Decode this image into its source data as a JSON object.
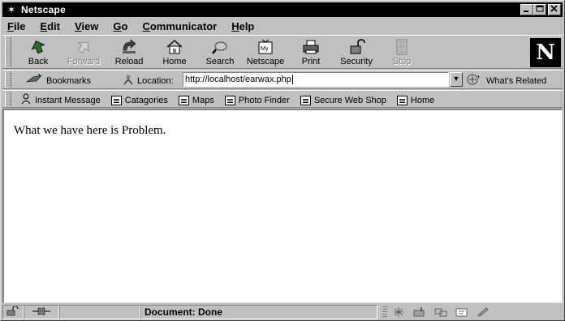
{
  "window": {
    "title": "Netscape",
    "controls": [
      "minimize",
      "maximize",
      "close"
    ]
  },
  "menu": [
    {
      "label": "File",
      "underline": "F"
    },
    {
      "label": "Edit",
      "underline": "E"
    },
    {
      "label": "View",
      "underline": "V"
    },
    {
      "label": "Go",
      "underline": "G"
    },
    {
      "label": "Communicator",
      "underline": "C"
    },
    {
      "label": "Help",
      "underline": "H"
    }
  ],
  "navigation_toolbar": {
    "buttons": [
      {
        "label": "Back",
        "icon": "back-arrow-icon",
        "enabled": true
      },
      {
        "label": "Forward",
        "icon": "forward-arrow-icon",
        "enabled": false
      },
      {
        "label": "Reload",
        "icon": "reload-icon",
        "enabled": true
      },
      {
        "label": "Home",
        "icon": "home-icon",
        "enabled": true
      },
      {
        "label": "Search",
        "icon": "search-icon",
        "enabled": true
      },
      {
        "label": "Netscape",
        "icon": "my-netscape-icon",
        "enabled": true
      },
      {
        "label": "Print",
        "icon": "printer-icon",
        "enabled": true
      },
      {
        "label": "Security",
        "icon": "padlock-icon",
        "enabled": true
      },
      {
        "label": "Stop",
        "icon": "stop-icon",
        "enabled": false
      }
    ],
    "logo": "N"
  },
  "location_bar": {
    "bookmarks_label": "Bookmarks",
    "location_label": "Location:",
    "url": "http://localhost/earwax.php",
    "related_label": "What's Related"
  },
  "personal_toolbar": {
    "items": [
      "Instant Message",
      "Catagories",
      "Maps",
      "Photo Finder",
      "Secure Web Shop",
      "Home"
    ]
  },
  "page": {
    "text": "What we have here is Problem."
  },
  "status_bar": {
    "text": "Document: Done"
  },
  "colors": {
    "chrome": "#c0c0c0",
    "titlebar": "#000000",
    "content_bg": "#ffffff"
  }
}
